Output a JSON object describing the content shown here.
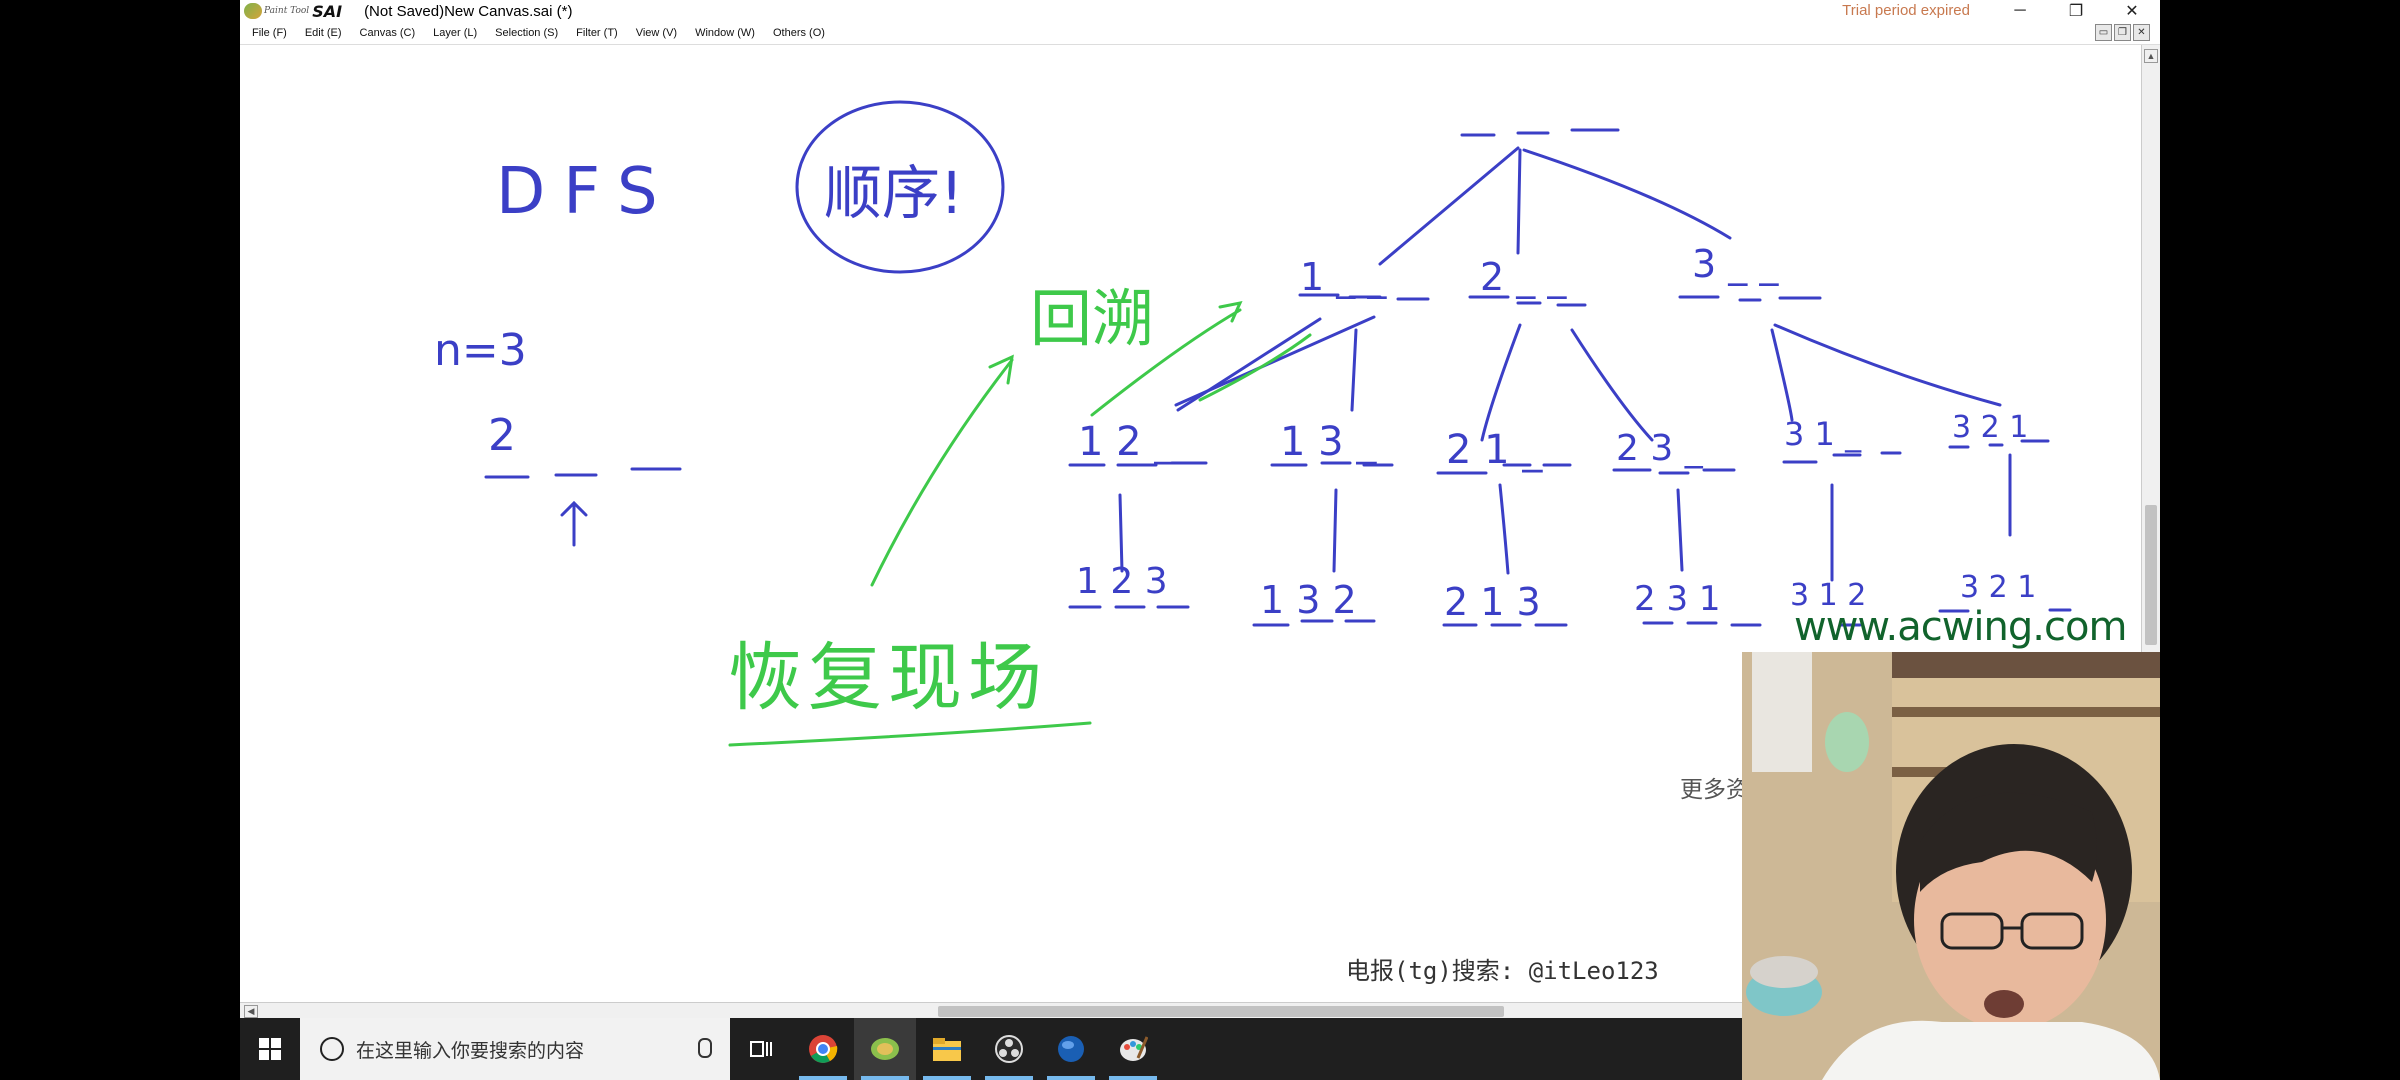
{
  "titlebar": {
    "app_name_small": "Paint Tool",
    "app_name": "SAI",
    "doc_title": "(Not Saved)New Canvas.sai (*)",
    "trial_notice": "Trial period expired",
    "minimize": "─",
    "restore": "❐",
    "close": "✕"
  },
  "menu": {
    "items": [
      "File (F)",
      "Edit (E)",
      "Canvas (C)",
      "Layer (L)",
      "Selection (S)",
      "Filter (T)",
      "View (V)",
      "Window (W)",
      "Others (O)"
    ]
  },
  "mdi_buttons": [
    "▭",
    "❐",
    "✕"
  ],
  "drawing": {
    "dfs": "DFS",
    "order": "顺序!",
    "n_eq": "n=3",
    "example_digit": "2",
    "backtrack": "回溯",
    "restore_scene": "恢复现场",
    "tree_root": "_ _ _",
    "level1": [
      "1 _ _",
      "2 _ _",
      "3 _ _"
    ],
    "level2": [
      "1 2 _",
      "1 3 _",
      "2 1 _",
      "2 3 _",
      "3 1 _",
      "3 2 1"
    ],
    "level3": [
      "1 2 3",
      "1 3 2",
      "2 1 3",
      "2 3 1",
      "3 1 2",
      "3 2 1"
    ]
  },
  "watermarks": {
    "more_resources": "更多资源: www.itjydl.com",
    "telegram": "电报(tg)搜索: @itLeo123",
    "site": "www.acwing.com"
  },
  "taskbar": {
    "search_placeholder": "在这里输入你要搜索的内容",
    "apps": [
      "task-view",
      "chrome",
      "paint-tool-sai",
      "file-explorer",
      "obs",
      "browser",
      "paint-app"
    ]
  },
  "colors": {
    "ink_blue": "#3b3fc6",
    "ink_green": "#3ec94a",
    "taskbar_bg": "#1f1f1f",
    "accent": "#76b9ed"
  }
}
